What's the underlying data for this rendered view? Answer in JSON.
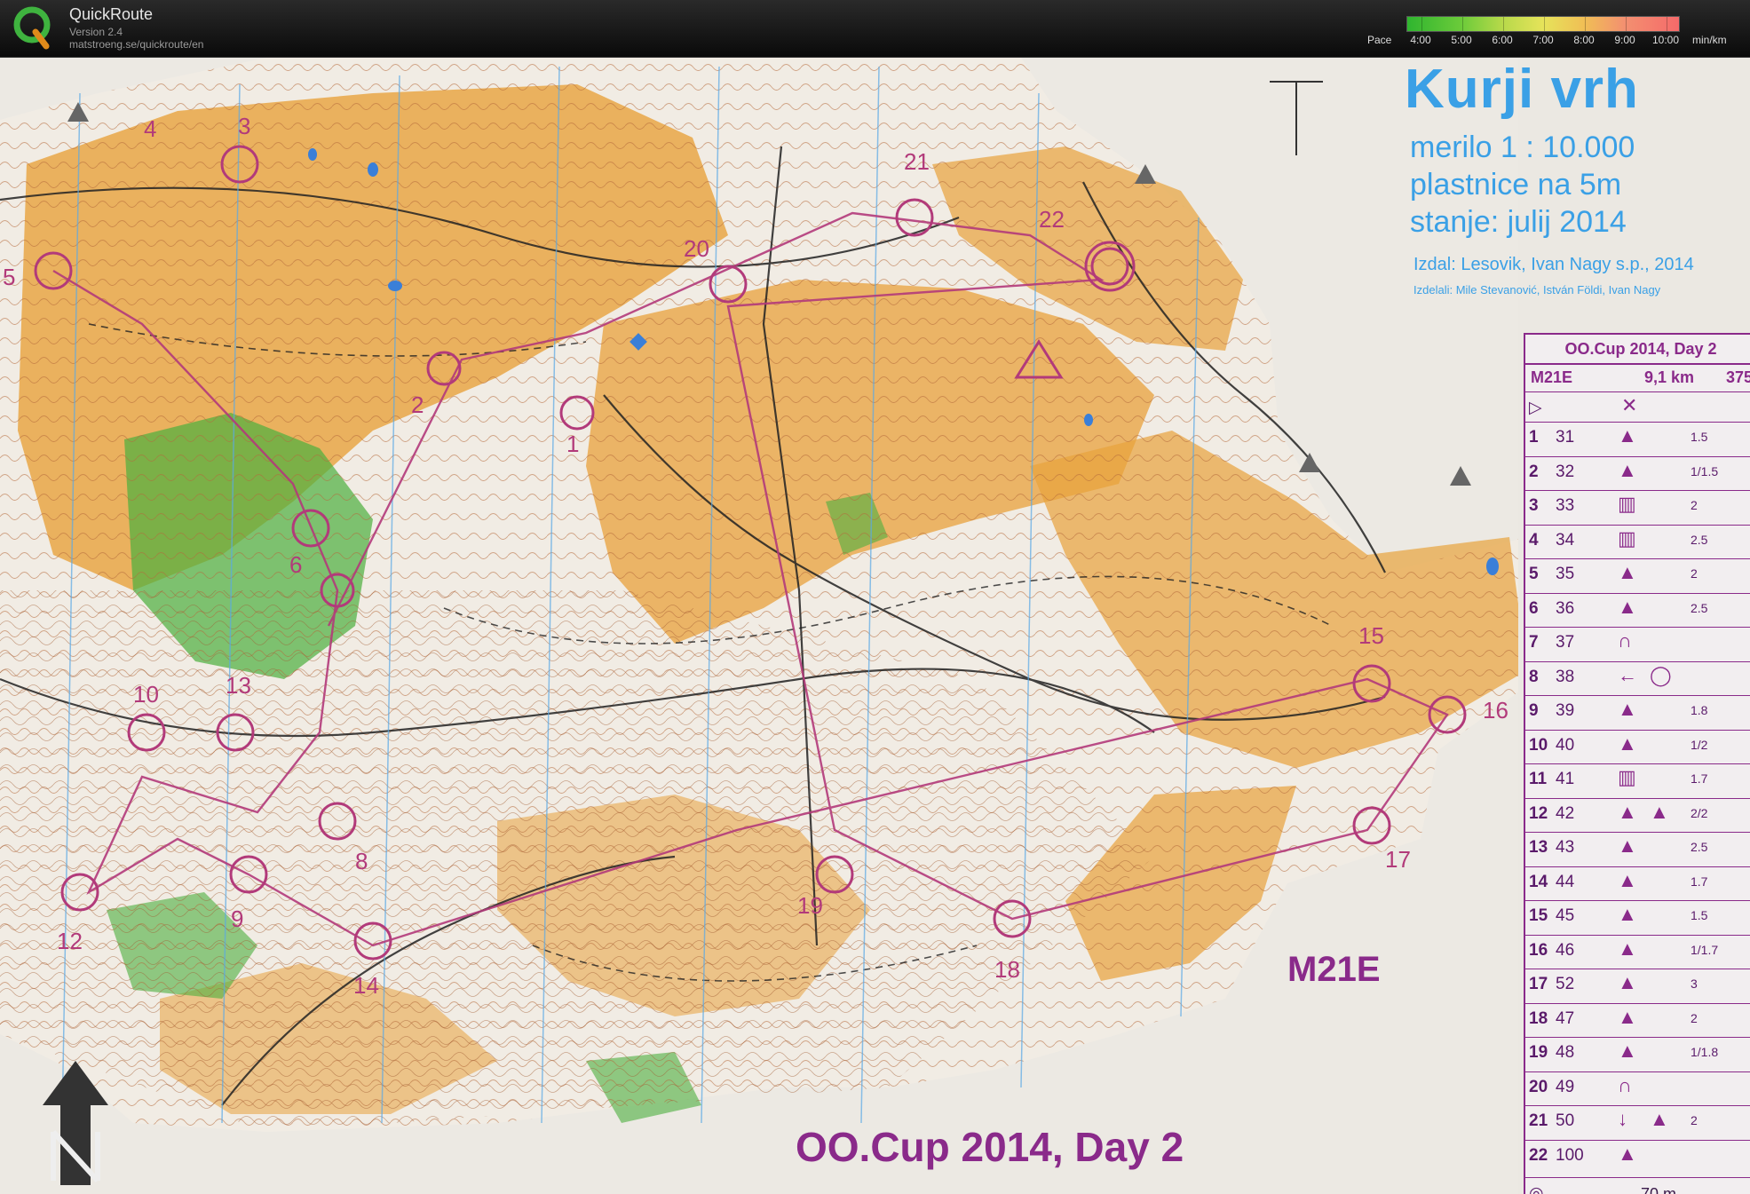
{
  "app": {
    "title": "QuickRoute",
    "version": "Version 2.4",
    "url": "matstroeng.se/quickroute/en"
  },
  "pace": {
    "label": "Pace",
    "ticks": [
      "4:00",
      "5:00",
      "6:00",
      "7:00",
      "8:00",
      "9:00",
      "10:00"
    ],
    "unit": "min/km"
  },
  "map": {
    "name": "Kurji vrh",
    "scale": "merilo 1 : 10.000",
    "contours": "plastnice na 5m",
    "status": "stanje: julij 2014",
    "publisher": "Izdal: Lesovik, Ivan Nagy s.p., 2014",
    "makers": "Izdelali: Mile Stevanović, István Földi, Ivan Nagy",
    "class_label": "M21E",
    "footer": "OO.Cup 2014, Day 2",
    "colors": {
      "terrain": "#e8a23c",
      "vegetation": "#4caf3d",
      "course": "#b23a7a",
      "text_blue": "#3aa0e6"
    },
    "controls": [
      {
        "label": "1"
      },
      {
        "label": "2"
      },
      {
        "label": "3"
      },
      {
        "label": "4"
      },
      {
        "label": "5"
      },
      {
        "label": "6"
      },
      {
        "label": "8"
      },
      {
        "label": "9"
      },
      {
        "label": "10"
      },
      {
        "label": "12"
      },
      {
        "label": "13"
      },
      {
        "label": "14"
      },
      {
        "label": "15"
      },
      {
        "label": "16"
      },
      {
        "label": "17"
      },
      {
        "label": "18"
      },
      {
        "label": "19"
      },
      {
        "label": "20"
      },
      {
        "label": "21"
      },
      {
        "label": "22"
      }
    ]
  },
  "description": {
    "title": "OO.Cup 2014, Day 2",
    "class": "M21E",
    "length": "9,1 km",
    "climb": "375",
    "footer": "70 m",
    "rows": [
      {
        "num": "1",
        "code": "31",
        "sym": "▲",
        "sym2": "",
        "dim": "1.5"
      },
      {
        "num": "2",
        "code": "32",
        "sym": "▲",
        "sym2": "",
        "dim": "1/1.5"
      },
      {
        "num": "3",
        "code": "33",
        "sym": "▥",
        "sym2": "",
        "dim": "2"
      },
      {
        "num": "4",
        "code": "34",
        "sym": "▥",
        "sym2": "",
        "dim": "2.5"
      },
      {
        "num": "5",
        "code": "35",
        "sym": "▲",
        "sym2": "",
        "dim": "2"
      },
      {
        "num": "6",
        "code": "36",
        "sym": "▲",
        "sym2": "",
        "dim": "2.5"
      },
      {
        "num": "7",
        "code": "37",
        "sym": "∩",
        "sym2": "",
        "dim": ""
      },
      {
        "num": "8",
        "code": "38",
        "sym": "←",
        "sym2": "◯",
        "dim": ""
      },
      {
        "num": "9",
        "code": "39",
        "sym": "▲",
        "sym2": "",
        "dim": "1.8"
      },
      {
        "num": "10",
        "code": "40",
        "sym": "▲",
        "sym2": "",
        "dim": "1/2"
      },
      {
        "num": "11",
        "code": "41",
        "sym": "▥",
        "sym2": "",
        "dim": "1.7"
      },
      {
        "num": "12",
        "code": "42",
        "sym": "▲",
        "sym2": "▲",
        "dim": "2/2"
      },
      {
        "num": "13",
        "code": "43",
        "sym": "▲",
        "sym2": "",
        "dim": "2.5"
      },
      {
        "num": "14",
        "code": "44",
        "sym": "▲",
        "sym2": "",
        "dim": "1.7"
      },
      {
        "num": "15",
        "code": "45",
        "sym": "▲",
        "sym2": "",
        "dim": "1.5"
      },
      {
        "num": "16",
        "code": "46",
        "sym": "▲",
        "sym2": "",
        "dim": "1/1.7"
      },
      {
        "num": "17",
        "code": "52",
        "sym": "▲",
        "sym2": "",
        "dim": "3"
      },
      {
        "num": "18",
        "code": "47",
        "sym": "▲",
        "sym2": "",
        "dim": "2"
      },
      {
        "num": "19",
        "code": "48",
        "sym": "▲",
        "sym2": "",
        "dim": "1/1.8"
      },
      {
        "num": "20",
        "code": "49",
        "sym": "∩",
        "sym2": "",
        "dim": ""
      },
      {
        "num": "21",
        "code": "50",
        "sym": "↓",
        "sym2": "▲",
        "dim": "2"
      },
      {
        "num": "22",
        "code": "100",
        "sym": "▲",
        "sym2": "",
        "dim": ""
      }
    ]
  }
}
